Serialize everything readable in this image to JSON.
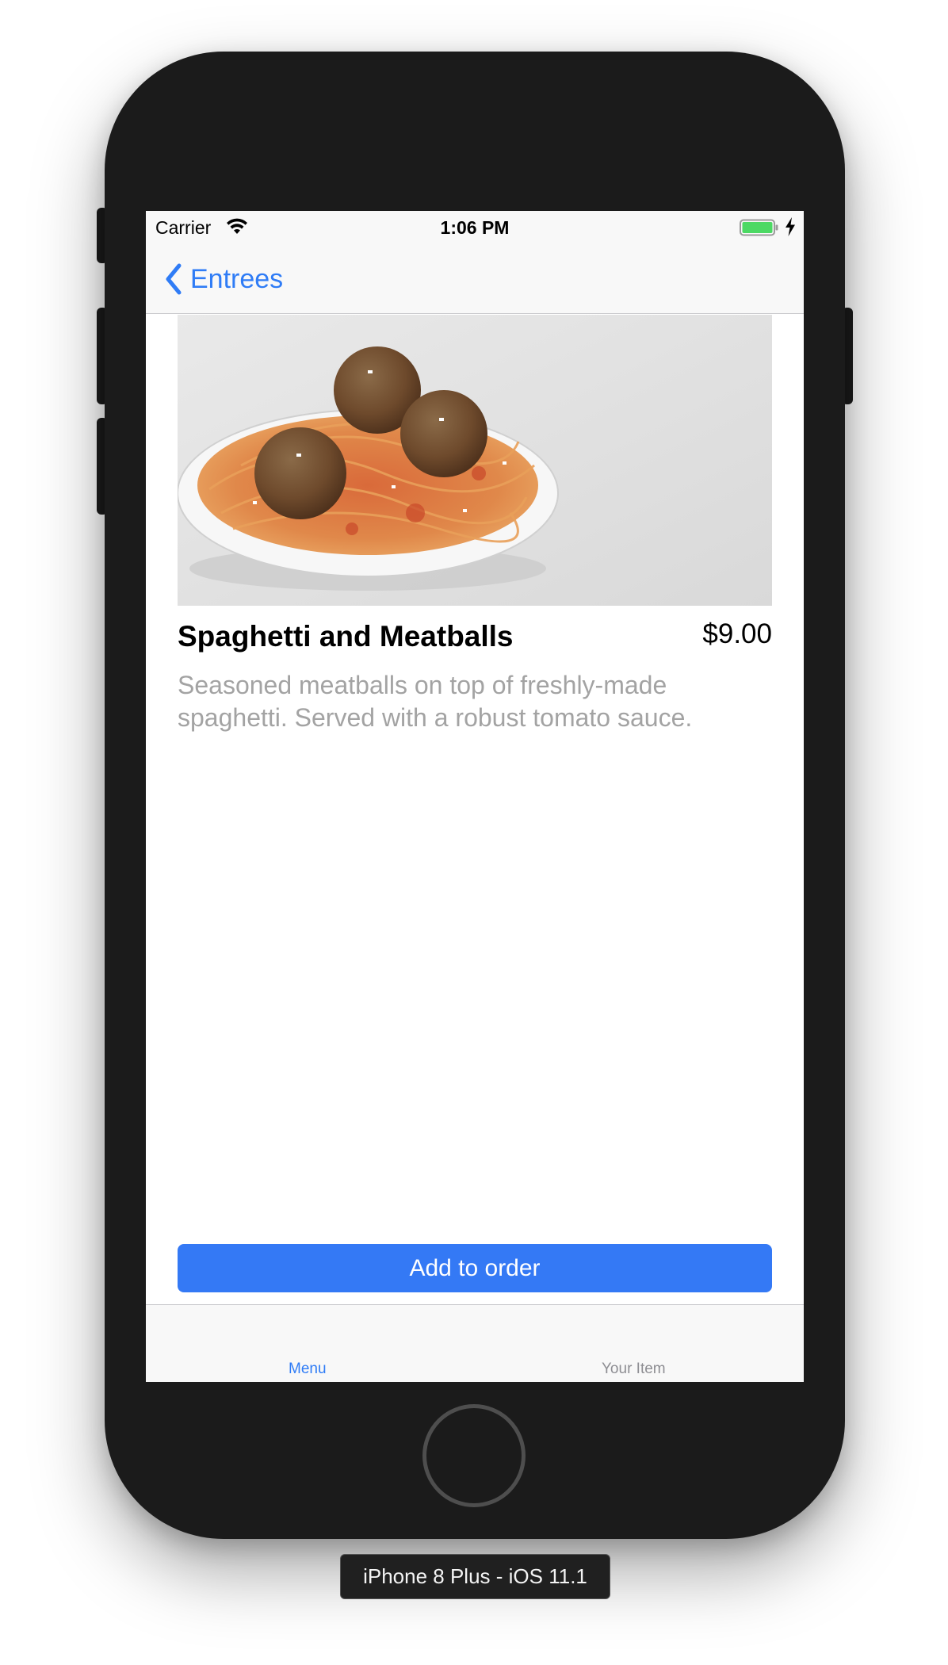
{
  "status_bar": {
    "carrier": "Carrier",
    "time": "1:06 PM",
    "icons": [
      "wifi-icon",
      "battery-icon",
      "charging-bolt-icon"
    ]
  },
  "nav_bar": {
    "back_label": "Entrees",
    "back_icon": "chevron-left-icon"
  },
  "item": {
    "image_alt": "spaghetti-and-meatballs-photo",
    "name": "Spaghetti and Meatballs",
    "price": "$9.00",
    "description": "Seasoned meatballs on top of freshly-made spaghetti. Served with a robust tomato sauce."
  },
  "actions": {
    "add_to_order": "Add to order"
  },
  "tab_bar": {
    "tabs": [
      {
        "label": "Menu",
        "selected": true
      },
      {
        "label": "Your Item",
        "selected": false
      }
    ]
  },
  "simulator": {
    "device_label": "iPhone 8 Plus - iOS 11.1"
  },
  "colors": {
    "accent": "#2f7cf6",
    "button": "#3479f5",
    "description_text": "#a3a3a3",
    "device_body": "#1b1b1b",
    "battery": "#4cd964"
  }
}
